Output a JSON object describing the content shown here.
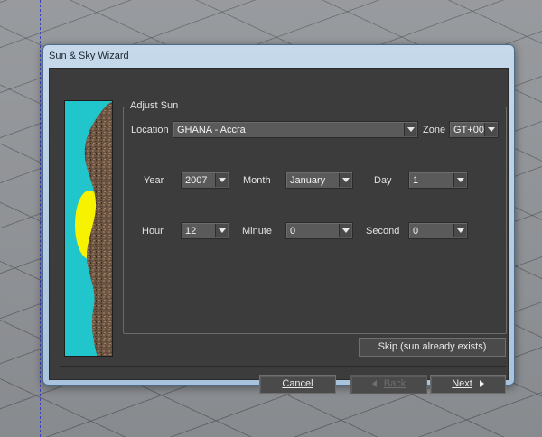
{
  "window": {
    "title": "Sun & Sky Wizard"
  },
  "group": {
    "title": "Adjust Sun"
  },
  "location": {
    "label": "Location",
    "value": "GHANA - Accra"
  },
  "zone": {
    "label": "Zone",
    "value": "GT+00"
  },
  "year": {
    "label": "Year",
    "value": "2007"
  },
  "month": {
    "label": "Month",
    "value": "January"
  },
  "day": {
    "label": "Day",
    "value": "1"
  },
  "hour": {
    "label": "Hour",
    "value": "12"
  },
  "minute": {
    "label": "Minute",
    "value": "0"
  },
  "second": {
    "label": "Second",
    "value": "0"
  },
  "buttons": {
    "skip": "Skip (sun already exists)",
    "cancel": "Cancel",
    "back": "Back",
    "next": "Next"
  },
  "colors": {
    "panel": "#3c3c3c",
    "sky": "#21c6cc",
    "sun": "#f7f200",
    "earth": "#6b5442",
    "title_bar": "#b7cde3"
  },
  "icons": {
    "back": "triangle-left-icon",
    "next": "triangle-right-icon",
    "dropdown": "chevron-down-icon"
  }
}
